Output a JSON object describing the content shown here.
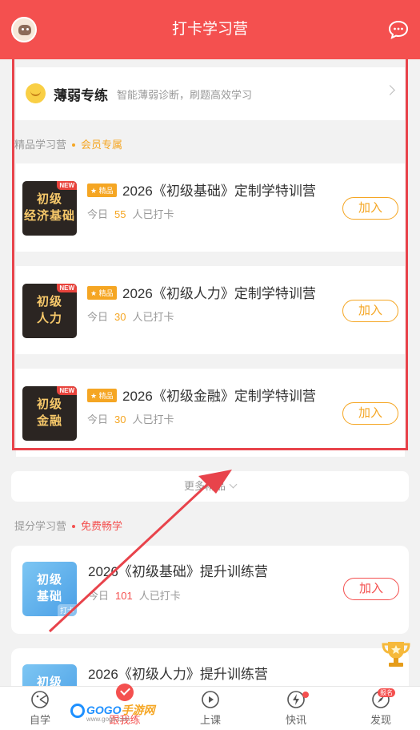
{
  "header": {
    "title": "打卡学习营",
    "avatar_icon": "avatar-icon",
    "message_icon": "chat-bubble-icon"
  },
  "weak_training": {
    "title": "薄弱专练",
    "subtitle": "智能薄弱诊断，刷题高效学习"
  },
  "premium_section": {
    "label": "精品学习营",
    "tag": "会员专属"
  },
  "premium_camps": [
    {
      "thumb_line1": "初级",
      "thumb_line2": "经济基础",
      "badge": "NEW",
      "tag": "精品",
      "title": "2026《初级基础》定制学特训营",
      "meta_prefix": "今日",
      "count": "55",
      "meta_suffix": "人已打卡",
      "button": "加入"
    },
    {
      "thumb_line1": "初级",
      "thumb_line2": "人力",
      "badge": "NEW",
      "tag": "精品",
      "title": "2026《初级人力》定制学特训营",
      "meta_prefix": "今日",
      "count": "30",
      "meta_suffix": "人已打卡",
      "button": "加入"
    },
    {
      "thumb_line1": "初级",
      "thumb_line2": "金融",
      "badge": "NEW",
      "tag": "精品",
      "title": "2026《初级金融》定制学特训营",
      "meta_prefix": "今日",
      "count": "30",
      "meta_suffix": "人已打卡",
      "button": "加入"
    }
  ],
  "more": {
    "label": "更多精品"
  },
  "improve_section": {
    "label": "提分学习营",
    "tag": "免费畅学"
  },
  "improve_camps": [
    {
      "thumb_line1": "初级",
      "thumb_line2": "基础",
      "thumb_tag": "打卡",
      "title": "2026《初级基础》提升训练营",
      "meta_prefix": "今日",
      "count": "101",
      "meta_suffix": "人已打卡",
      "button": "加入"
    },
    {
      "thumb_line1": "初级",
      "thumb_line2": "",
      "title": "2026《初级人力》提升训练营"
    }
  ],
  "tabbar": {
    "items": [
      {
        "label": "自学",
        "icon": "self-study-icon"
      },
      {
        "label": "跟我练",
        "icon": "practice-check-icon"
      },
      {
        "label": "上课",
        "icon": "play-circle-icon"
      },
      {
        "label": "快讯",
        "icon": "lightning-icon"
      },
      {
        "label": "发现",
        "icon": "compass-icon",
        "badge": "报名"
      }
    ]
  },
  "watermark": {
    "text_blue": "GOGO",
    "text_orange": "手游网",
    "sub": "www.gogo.com"
  },
  "colors": {
    "brand": "#f4504f",
    "accent": "#f5a623",
    "highlight_border": "#e8434b"
  }
}
